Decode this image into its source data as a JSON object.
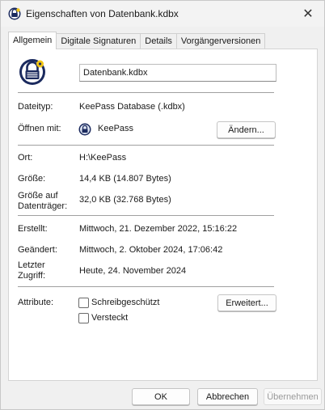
{
  "window": {
    "title": "Eigenschaften von Datenbank.kdbx",
    "close_glyph": "✕"
  },
  "tabs": [
    {
      "label": "Allgemein",
      "active": true
    },
    {
      "label": "Digitale Signaturen",
      "active": false
    },
    {
      "label": "Details",
      "active": false
    },
    {
      "label": "Vorgängerversionen",
      "active": false
    }
  ],
  "general": {
    "file_icon": "keepass-lock-icon",
    "file_name": "Datenbank.kdbx",
    "type_label": "Dateityp:",
    "type_value": "KeePass Database (.kdbx)",
    "opens_with_label": "Öffnen mit:",
    "opens_with_app": "KeePass",
    "opens_with_app_icon": "keepass-app-icon",
    "change_button": "Ändern...",
    "location_label": "Ort:",
    "location_value": "H:\\KeePass",
    "size_label": "Größe:",
    "size_value": "14,4 KB (14.807 Bytes)",
    "size_on_disk_label_1": "Größe auf",
    "size_on_disk_label_2": "Datenträger:",
    "size_on_disk_value": "32,0 KB (32.768 Bytes)",
    "created_label": "Erstellt:",
    "created_value": "Mittwoch, 21. Dezember 2022, 15:16:22",
    "modified_label": "Geändert:",
    "modified_value": "Mittwoch, 2. Oktober 2024, 17:06:42",
    "accessed_label_1": "Letzter",
    "accessed_label_2": "Zugriff:",
    "accessed_value": "Heute, 24. November 2024",
    "attributes_label": "Attribute:",
    "readonly_label": "Schreibgeschützt",
    "readonly_checked": false,
    "hidden_label": "Versteckt",
    "hidden_checked": false,
    "advanced_button": "Erweitert..."
  },
  "footer": {
    "ok": "OK",
    "cancel": "Abbrechen",
    "apply": "Übernehmen"
  },
  "colors": {
    "keepass_blue": "#1b2a5e",
    "keepass_yellow": "#f3c614"
  }
}
